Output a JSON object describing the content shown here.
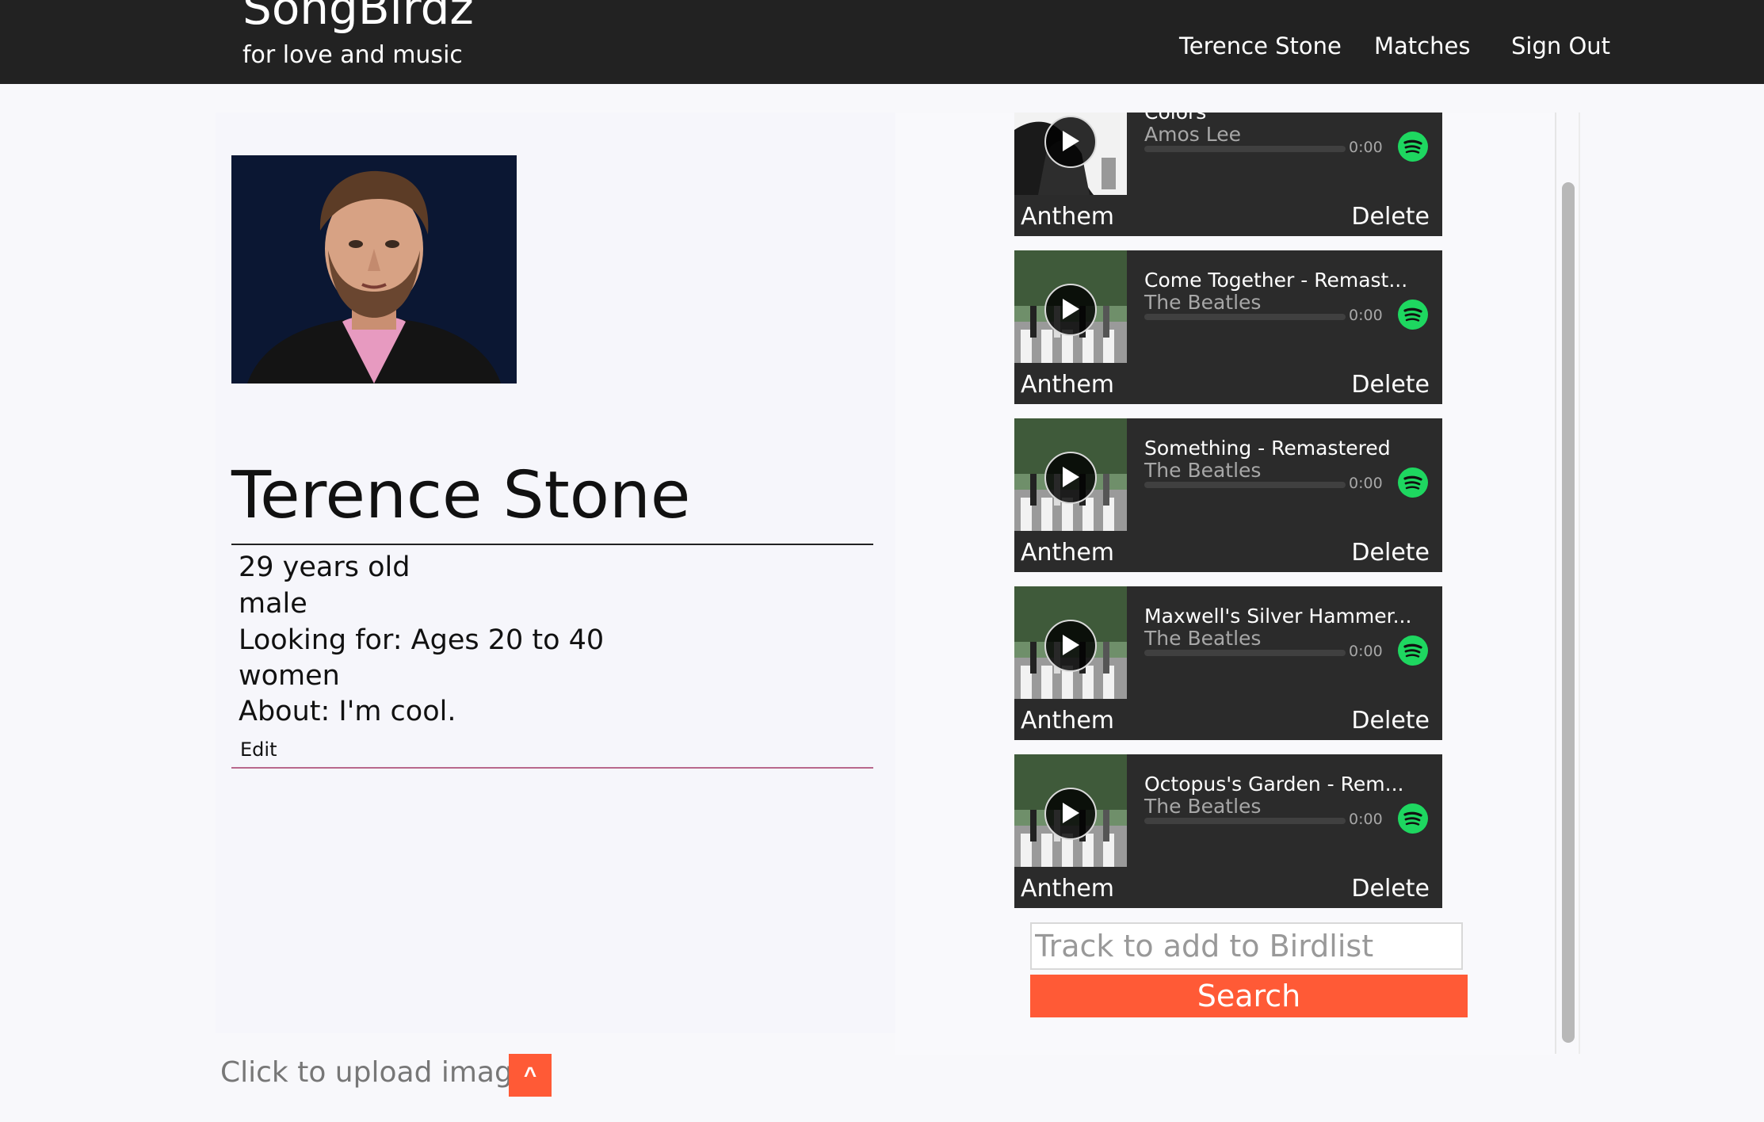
{
  "header": {
    "brand_title": "SongBirdz",
    "brand_tagline": "for love and music",
    "nav": {
      "profile_link": "Terence Stone",
      "matches_link": "Matches",
      "signout_link": "Sign Out"
    }
  },
  "profile": {
    "name": "Terence Stone",
    "age_line": "29 years old",
    "gender": "male",
    "looking_for": "Looking for: Ages 20 to 40",
    "interested_in": "women",
    "about": "About: I'm cool.",
    "edit_label": "Edit"
  },
  "upload": {
    "label": "Click to upload image",
    "button_label": "^"
  },
  "playlist": {
    "tracks": [
      {
        "title": "Colors",
        "artist": "Amos Lee",
        "time": "0:00",
        "anthem_label": "Anthem",
        "delete_label": "Delete"
      },
      {
        "title": "Come Together - Remast...",
        "artist": "The Beatles",
        "time": "0:00",
        "anthem_label": "Anthem",
        "delete_label": "Delete"
      },
      {
        "title": "Something - Remastered",
        "artist": "The Beatles",
        "time": "0:00",
        "anthem_label": "Anthem",
        "delete_label": "Delete"
      },
      {
        "title": "Maxwell's Silver Hammer...",
        "artist": "The Beatles",
        "time": "0:00",
        "anthem_label": "Anthem",
        "delete_label": "Delete"
      },
      {
        "title": "Octopus's Garden - Rem...",
        "artist": "The Beatles",
        "time": "0:00",
        "anthem_label": "Anthem",
        "delete_label": "Delete"
      }
    ]
  },
  "search": {
    "placeholder": "Track to add to Birdlist",
    "value": "",
    "button_label": "Search"
  },
  "colors": {
    "navbar_bg": "#222222",
    "accent_orange": "#ff5a36",
    "card_bg": "#2b2b2b",
    "spotify_green": "#1ed760",
    "edit_rule": "#b9688c"
  }
}
